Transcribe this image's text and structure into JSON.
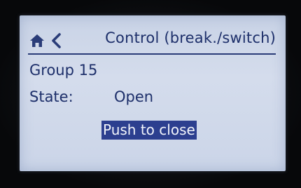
{
  "header": {
    "home_icon": "home-icon",
    "back_icon": "chevron-left-icon",
    "title": "Control (break./switch)"
  },
  "info": {
    "group": "Group 15",
    "state_label": "State:",
    "state_value": "Open"
  },
  "action": {
    "label": "Push to close"
  },
  "colors": {
    "screen_background": "#cbd5e8",
    "text": "#1d2f6a",
    "highlight": "#2c3f8f",
    "highlight_text": "#f2f5fb"
  }
}
